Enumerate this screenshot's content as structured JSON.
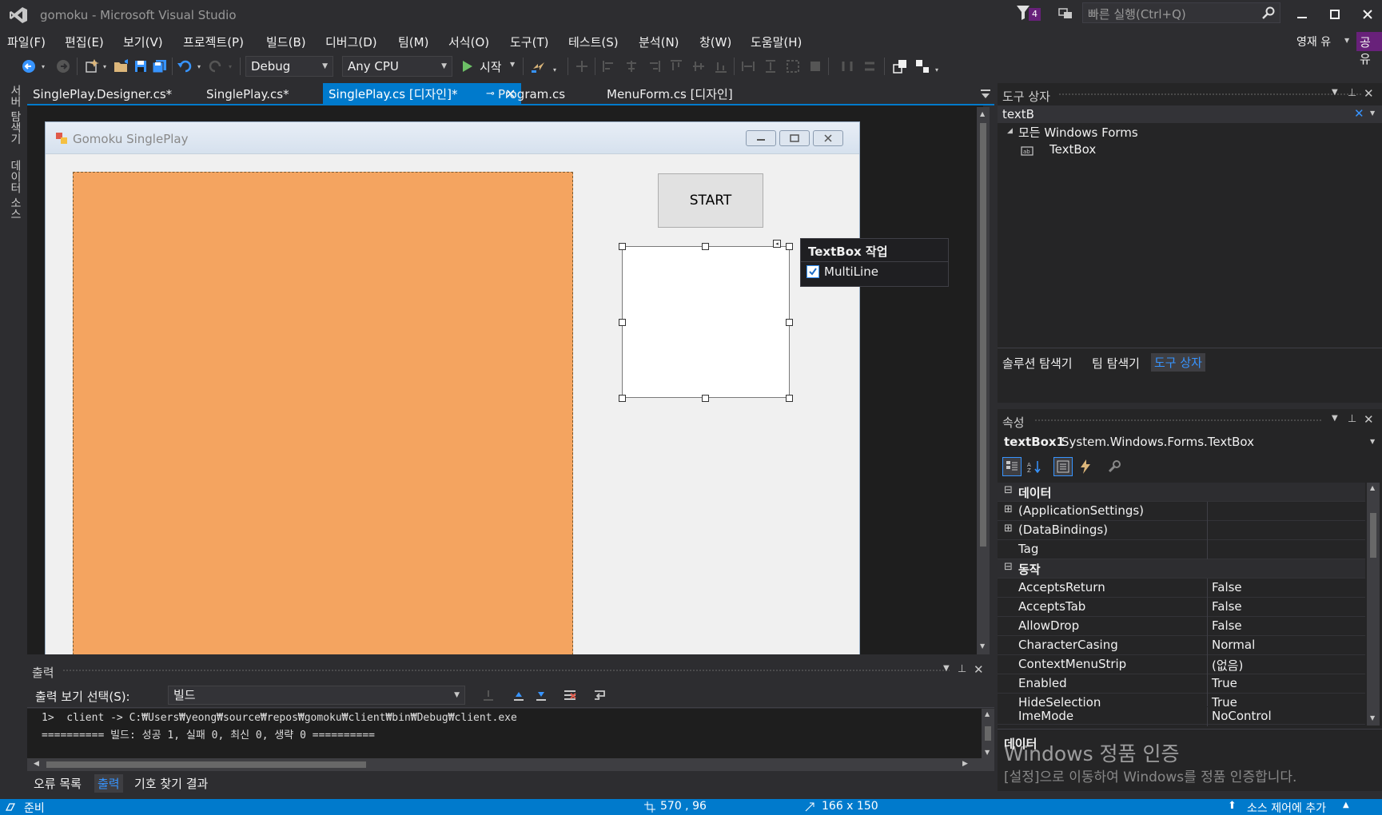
{
  "window": {
    "title": "gomoku - Microsoft Visual Studio",
    "notif_count": "4",
    "quick_launch_placeholder": "빠른 실행(Ctrl+Q)",
    "user": "영재 유",
    "share": "공유"
  },
  "menu": [
    "파일(F)",
    "편집(E)",
    "보기(V)",
    "프로젝트(P)",
    "빌드(B)",
    "디버그(D)",
    "팀(M)",
    "서식(O)",
    "도구(T)",
    "테스트(S)",
    "분석(N)",
    "창(W)",
    "도움말(H)"
  ],
  "toolbar": {
    "config": "Debug",
    "platform": "Any CPU",
    "start_label": "시작"
  },
  "left_strip": {
    "server_explorer": "서버 탐색기",
    "data_sources": "데이터 소스"
  },
  "doc_tabs": [
    {
      "label": "SinglePlay.Designer.cs*"
    },
    {
      "label": "SinglePlay.cs*"
    },
    {
      "label": "SinglePlay.cs [디자인]*"
    },
    {
      "label": "Program.cs"
    },
    {
      "label": "MenuForm.cs [디자인]"
    }
  ],
  "form": {
    "title": "Gomoku SinglePlay",
    "start_button": "START",
    "smart_tag_title": "TextBox 작업",
    "smart_tag_option": "MultiLine",
    "multiline_checked": true
  },
  "output": {
    "header": "출력",
    "show_from_label": "출력 보기 선택(S):",
    "show_from_value": "빌드",
    "lines": [
      "1>  client -> C:₩Users₩yeong₩source₩repos₩gomoku₩client₩bin₩Debug₩client.exe",
      "========== 빌드: 성공 1, 실패 0, 최신 0, 생략 0 =========="
    ],
    "bottom_tabs": [
      "오류 목록",
      "출력",
      "기호 찾기 결과"
    ]
  },
  "toolbox": {
    "header": "도구 상자",
    "search": "textB",
    "group": "모든 Windows Forms",
    "item": "TextBox",
    "bottom_tabs": [
      "솔루션 탐색기",
      "팀 탐색기",
      "도구 상자"
    ]
  },
  "properties": {
    "header": "속성",
    "object_name": "textBox1",
    "object_type": "System.Windows.Forms.TextBox",
    "rows": [
      {
        "kind": "category",
        "name": "데이터",
        "value": ""
      },
      {
        "kind": "expandable",
        "name": "(ApplicationSettings)",
        "value": ""
      },
      {
        "kind": "expandable",
        "name": "(DataBindings)",
        "value": ""
      },
      {
        "kind": "prop",
        "name": "Tag",
        "value": ""
      },
      {
        "kind": "category",
        "name": "동작",
        "value": ""
      },
      {
        "kind": "prop",
        "name": "AcceptsReturn",
        "value": "False"
      },
      {
        "kind": "prop",
        "name": "AcceptsTab",
        "value": "False"
      },
      {
        "kind": "prop",
        "name": "AllowDrop",
        "value": "False"
      },
      {
        "kind": "prop",
        "name": "CharacterCasing",
        "value": "Normal"
      },
      {
        "kind": "prop",
        "name": "ContextMenuStrip",
        "value": "(없음)"
      },
      {
        "kind": "prop",
        "name": "Enabled",
        "value": "True"
      },
      {
        "kind": "prop",
        "name": "HideSelection",
        "value": "True"
      },
      {
        "kind": "prop",
        "name": "ImeMode",
        "value": "NoControl"
      }
    ],
    "description_title": "데이터",
    "watermark_title": "Windows 정품 인증",
    "watermark_sub": "[설정]으로 이동하여 Windows를 정품 인증합니다."
  },
  "status": {
    "ready": "준비",
    "position": "570 , 96",
    "size": "166 x 150",
    "source_control": "소스 제어에 추가"
  },
  "colors": {
    "accent": "#007acc",
    "board": "#f4a460",
    "background": "#2d2d30"
  }
}
